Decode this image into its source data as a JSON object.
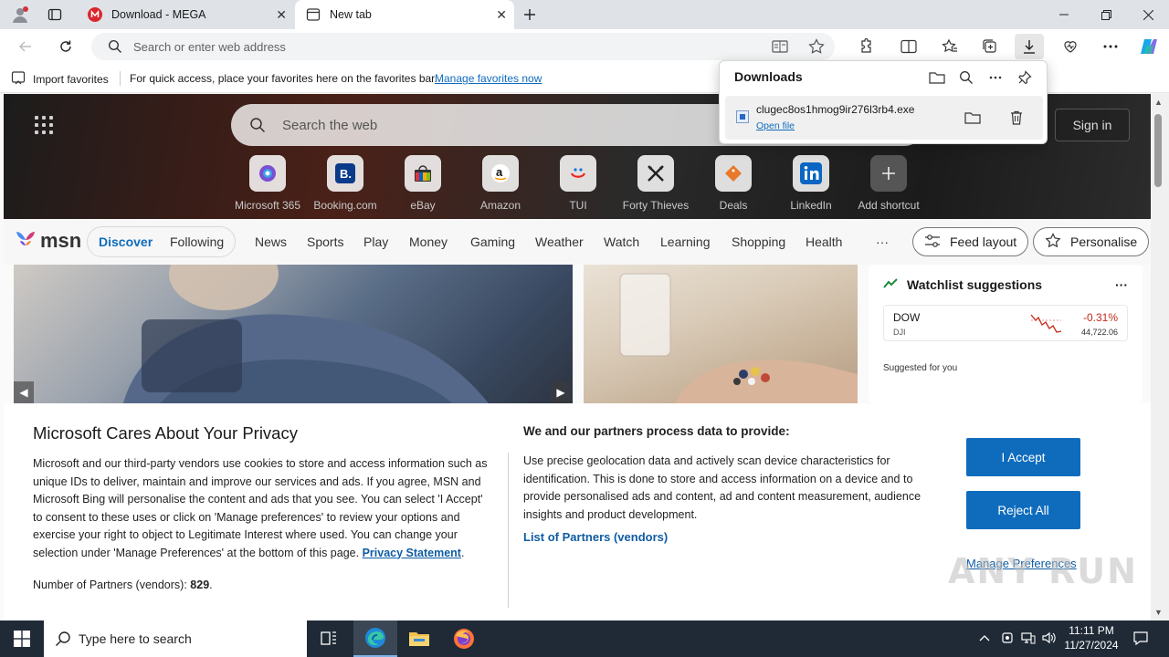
{
  "browser": {
    "tabs": [
      {
        "title": "Download - MEGA",
        "icon": "mega-logo-icon",
        "active": false
      },
      {
        "title": "New tab",
        "icon": "newtab-icon",
        "active": true
      }
    ],
    "address_placeholder": "Search or enter web address",
    "favorites_bar": {
      "import_label": "Import favorites",
      "message": "For quick access, place your favorites here on the favorites bar.",
      "manage_link": "Manage favorites now"
    }
  },
  "downloads": {
    "title": "Downloads",
    "item": {
      "filename": "clugec8os1hmog9ir276l3rb4.exe",
      "open_label": "Open file"
    }
  },
  "newtab": {
    "search_placeholder": "Search the web",
    "signin_label": "Sign in",
    "shortcuts": [
      {
        "label": "Microsoft 365",
        "icon": "m365-icon"
      },
      {
        "label": "Booking.com",
        "icon": "booking-icon"
      },
      {
        "label": "eBay",
        "icon": "ebay-icon"
      },
      {
        "label": "Amazon",
        "icon": "amazon-icon"
      },
      {
        "label": "TUI",
        "icon": "tui-icon"
      },
      {
        "label": "Forty Thieves",
        "icon": "forty-thieves-icon"
      },
      {
        "label": "Deals",
        "icon": "deals-icon"
      },
      {
        "label": "LinkedIn",
        "icon": "linkedin-icon"
      },
      {
        "label": "Add shortcut",
        "icon": "plus-icon"
      }
    ],
    "msn": {
      "logo_text": "msn",
      "tabs": [
        "Discover",
        "Following"
      ],
      "nav": [
        "News",
        "Sports",
        "Play",
        "Money",
        "Gaming",
        "Weather",
        "Watch",
        "Learning",
        "Shopping",
        "Health"
      ],
      "more": "···",
      "feed_layout": "Feed layout",
      "personalise": "Personalise"
    },
    "watchlist": {
      "title": "Watchlist suggestions",
      "stock": {
        "symbol": "DOW",
        "exchange": "DJI",
        "change": "-0.31%",
        "price": "44,722.06"
      },
      "suggested_label": "Suggested for you"
    }
  },
  "privacy": {
    "title": "Microsoft Cares About Your Privacy",
    "body": "Microsoft and our third-party vendors use cookies to store and access information such as unique IDs to deliver, maintain and improve our services and ads. If you agree, MSN and Microsoft Bing will personalise the content and ads that you see. You can select 'I Accept' to consent to these uses or click on 'Manage preferences' to review your options and exercise your right to object to Legitimate Interest where used.  You can change your selection under 'Manage Preferences' at the bottom of this page.",
    "statement_link": "Privacy Statement",
    "partners_count_label": "Number of Partners (vendors):",
    "partners_count": "829",
    "purposes_title": "We and our partners process data to provide:",
    "purposes_body": "Use precise geolocation data and actively scan device characteristics for identification. This is done to store and access information on a device and to provide personalised ads and content, ad and content measurement, audience insights and product development.",
    "partners_link": "List of Partners (vendors)",
    "accept": "I Accept",
    "reject": "Reject All",
    "manage": "Manage Preferences"
  },
  "watermark": "ANY RUN",
  "taskbar": {
    "search_placeholder": "Type here to search",
    "time": "11:11 PM",
    "date": "11/27/2024"
  }
}
